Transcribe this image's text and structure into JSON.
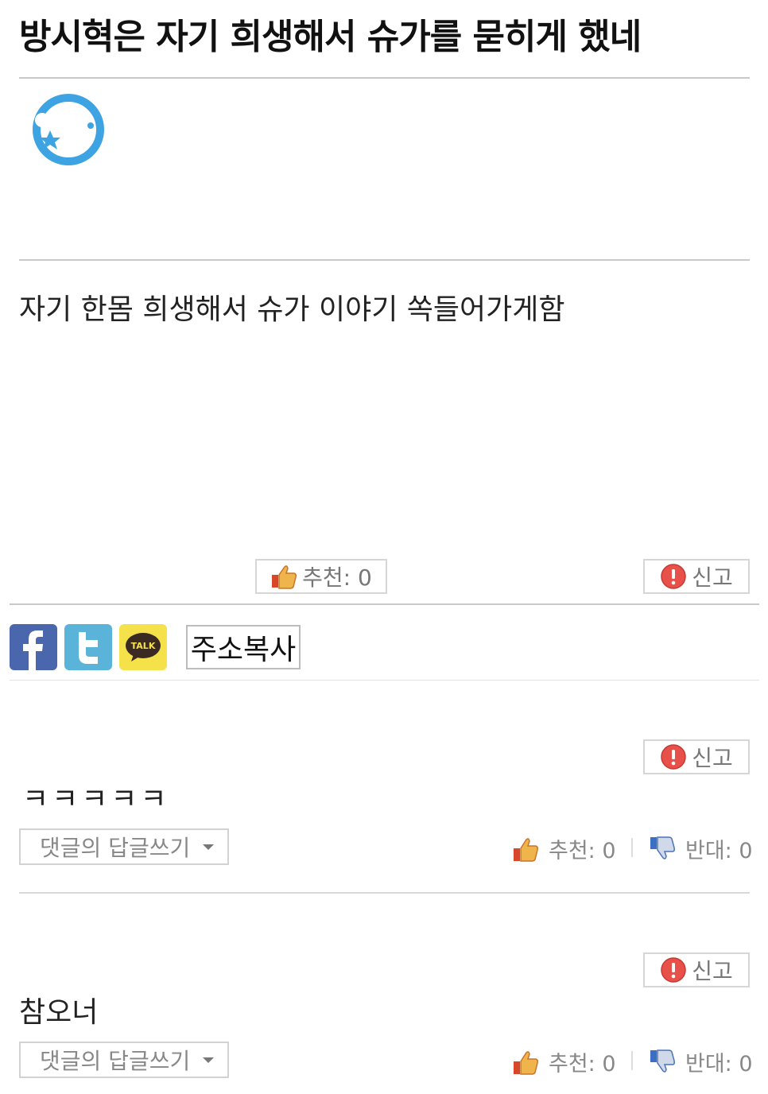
{
  "post": {
    "title": "방시혁은 자기 희생해서 슈가를 묻히게 했네",
    "body": "자기 한몸 희생해서 슈가 이야기 쏙들어가게함",
    "recommend_label": "추천: 0",
    "report_label": "신고"
  },
  "share": {
    "icons": [
      "facebook-icon",
      "twitter-icon",
      "kakaotalk-icon"
    ],
    "kakao_text": "TALK",
    "copy_url_label": "주소복사"
  },
  "comments": [
    {
      "text": "ㅋㅋㅋㅋㅋ",
      "report_label": "신고",
      "reply_label": "댓글의 답글쓰기",
      "recommend_label": "추천: 0",
      "oppose_label": "반대: 0"
    },
    {
      "text": "참오너",
      "report_label": "신고",
      "reply_label": "댓글의 답글쓰기",
      "recommend_label": "추천: 0",
      "oppose_label": "반대: 0"
    }
  ],
  "colors": {
    "avatar_blue": "#3ea3e3",
    "facebook": "#4a67ad",
    "twitter": "#5ab3d8",
    "kakao": "#f5e24a",
    "report_red": "#e8504a",
    "thumb_orange": "#e9863a"
  }
}
